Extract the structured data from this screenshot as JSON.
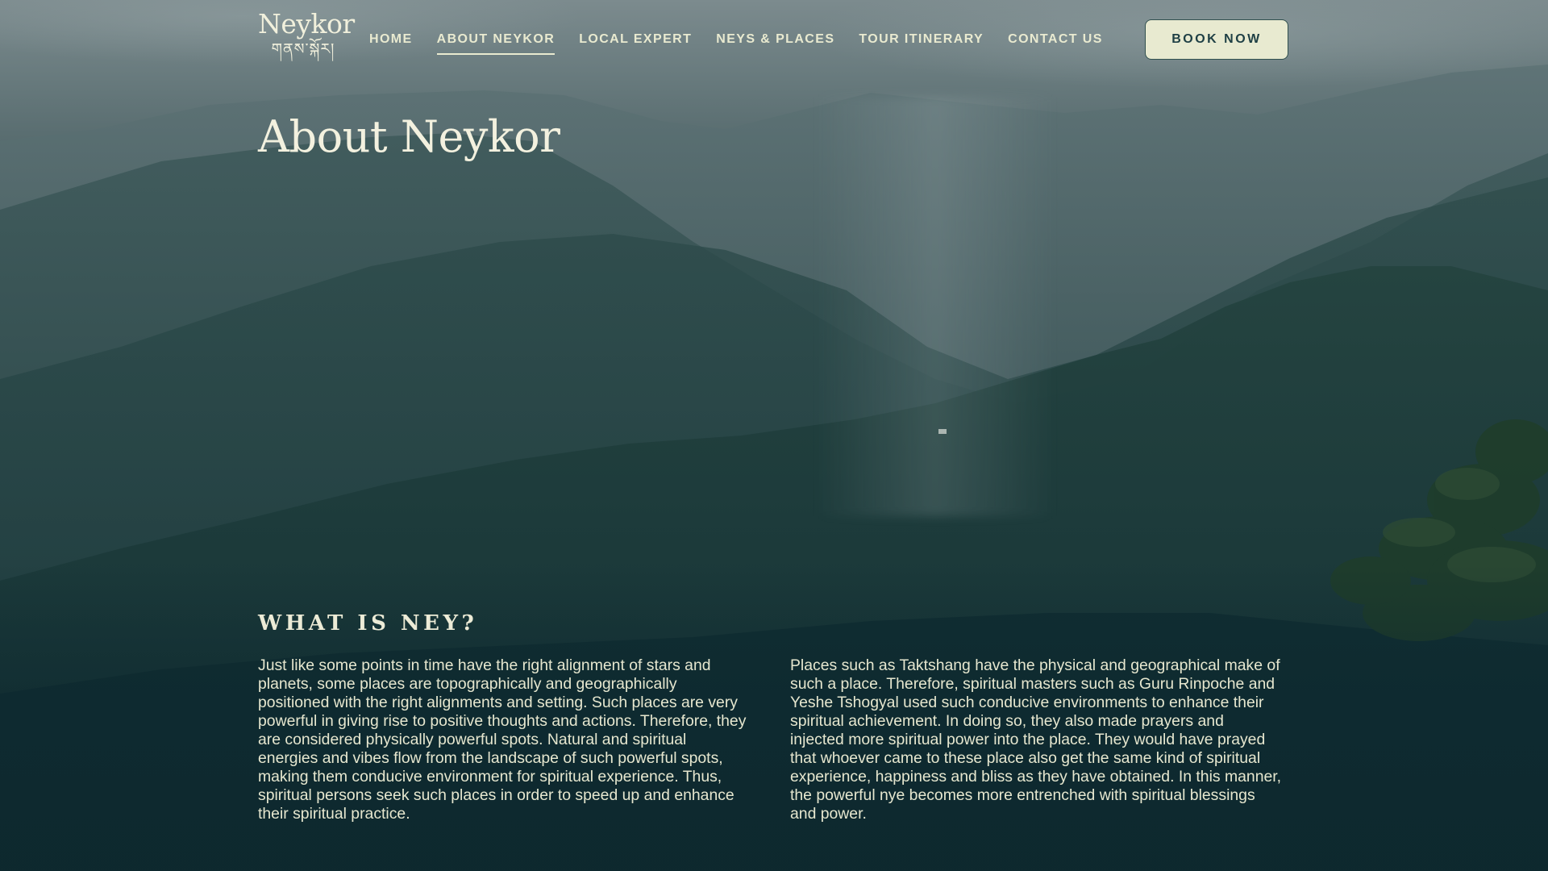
{
  "brand": {
    "name": "Neykor",
    "script": "གནས་སྐོར།"
  },
  "nav": {
    "items": [
      {
        "label": "HOME",
        "active": false
      },
      {
        "label": "ABOUT NEYKOR",
        "active": true
      },
      {
        "label": "LOCAL EXPERT",
        "active": false
      },
      {
        "label": "NEYS & PLACES",
        "active": false
      },
      {
        "label": "TOUR ITINERARY",
        "active": false
      },
      {
        "label": "CONTACT US",
        "active": false
      }
    ],
    "cta_label": "BOOK NOW"
  },
  "page_title": "About Neykor",
  "section": {
    "heading": "WHAT IS NEY?",
    "paragraph_left": "Just like some points in time have the right alignment of stars and planets, some places are topographically and geographically positioned with the right alignments and setting. Such places are very powerful in giving rise to positive thoughts and actions. Therefore, they are considered physically powerful spots. Natural and spiritual energies and vibes flow from the landscape of such powerful spots, making them conducive environment for spiritual experience. Thus, spiritual persons seek such places in order to speed up and enhance their spiritual practice.",
    "paragraph_right": "Places such as Taktshang have the physical and geographical make of such a place. Therefore, spiritual masters such as Guru Rinpoche and Yeshe Tshogyal used such conducive environments to enhance their spiritual achievement. In doing so, they also made prayers and injected more spiritual power into the place. They would have prayed that whoever came to these place also get the same kind of spiritual experience, happiness and bliss as they have obtained. In this manner, the powerful nye becomes more entrenched with spiritual blessings and power."
  },
  "colors": {
    "cream": "#e9ead0",
    "dark_teal": "#0f2c33",
    "button_text": "#1e3f44"
  }
}
